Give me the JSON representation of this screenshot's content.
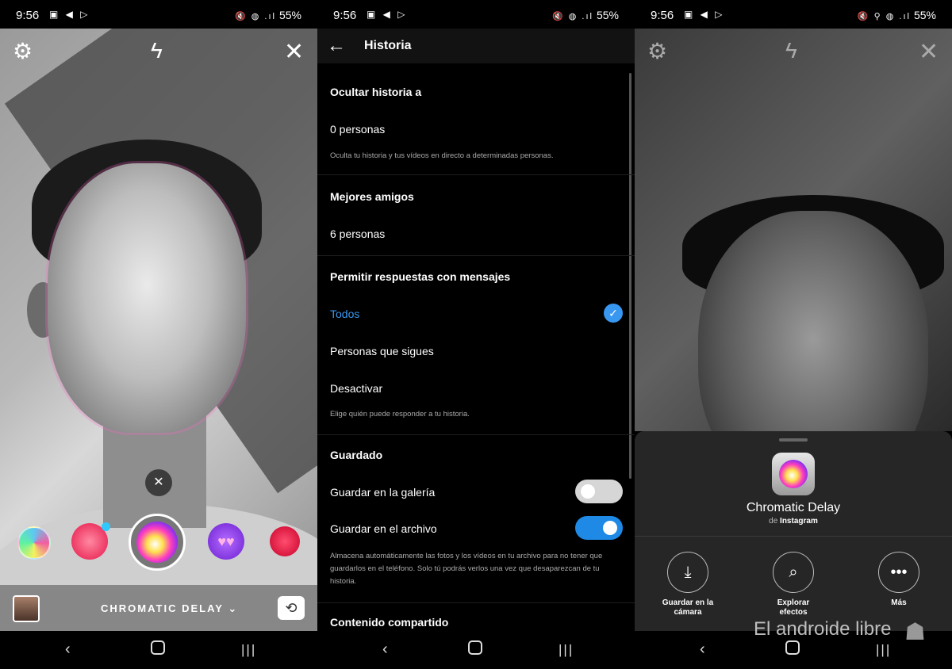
{
  "status": {
    "s1": {
      "time": "9:56",
      "icons": "▣ ◀ ▷",
      "right_icons": "🔇 ◍ .ıl",
      "battery": "55%"
    },
    "s2": {
      "time": "9:56",
      "icons": "▣ ◀ ▷",
      "right_icons": "🔇 ◍ .ıl",
      "battery": "55%"
    },
    "s3": {
      "time": "9:56",
      "icons": "▣ ◀ ▷",
      "right_icons": "🔇 ⚲ ◍ .ıl",
      "battery": "55%"
    }
  },
  "camera": {
    "effect_label": "CHROMATIC DELAY",
    "dropdown_glyph": "⌄",
    "carousel_close": "✕"
  },
  "settings": {
    "title": "Historia",
    "back_glyph": "←",
    "hide_story": {
      "header": "Ocultar historia a",
      "value": "0 personas",
      "desc": "Oculta tu historia y tus vídeos en directo a determinadas personas."
    },
    "close_friends": {
      "header": "Mejores amigos",
      "value": "6 personas"
    },
    "replies": {
      "header": "Permitir respuestas con mensajes",
      "options": [
        "Todos",
        "Personas que sigues",
        "Desactivar"
      ],
      "selected": "Todos",
      "desc": "Elige quién puede responder a tu historia."
    },
    "saving": {
      "header": "Guardado",
      "gallery_label": "Guardar en la galería",
      "gallery_on": false,
      "archive_label": "Guardar en el archivo",
      "archive_on": true,
      "desc": "Almacena automáticamente las fotos y los vídeos en tu archivo para no tener que guardarlos en el teléfono. Solo tú podrás verlos una vez que desaparezcan de tu historia."
    },
    "shared": {
      "header": "Contenido compartido"
    }
  },
  "sheet": {
    "effect_name": "Chromatic Delay",
    "by_prefix": "de",
    "by_author": "Instagram",
    "actions": [
      {
        "label_line1": "Guardar en la",
        "label_line2": "cámara",
        "icon": "download-icon"
      },
      {
        "label_line1": "Explorar",
        "label_line2": "efectos",
        "icon": "search-sparkle-icon"
      },
      {
        "label_line1": "Más",
        "label_line2": "",
        "icon": "more-icon"
      }
    ]
  },
  "watermark": {
    "text": "El androide libre"
  },
  "colors": {
    "accent_blue": "#3897f0",
    "toggle_on": "#1e8ae6",
    "toggle_off": "#d6d6d6",
    "sheet_bg": "#262626"
  }
}
